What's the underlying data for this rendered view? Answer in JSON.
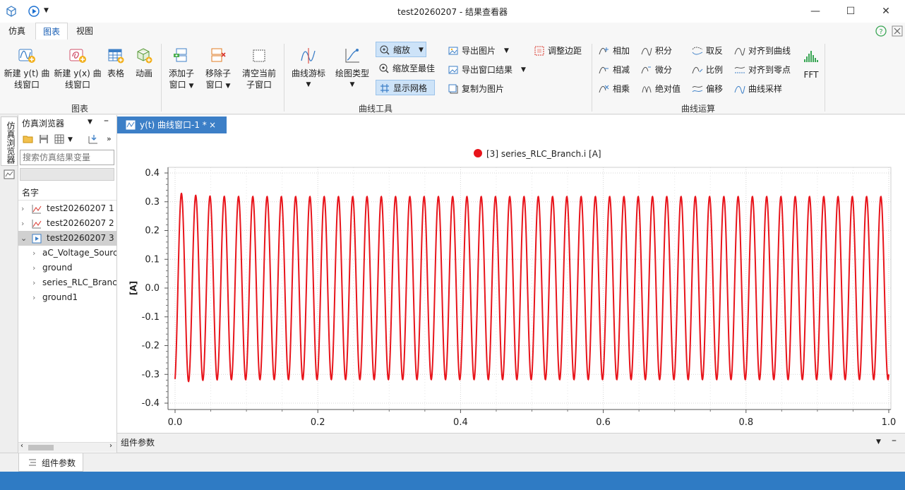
{
  "window": {
    "title": "test20260207 - 结果查看器",
    "minimize": "—",
    "maximize": "☐",
    "close": "✕"
  },
  "menu": {
    "tabs": [
      "仿真",
      "图表",
      "视图"
    ],
    "active_index": 1,
    "help": "?",
    "close_doc": "✕"
  },
  "ribbon": {
    "chart_group": {
      "label": "图表",
      "new_yt_line1": "新建 y(t) 曲",
      "new_yt_line2": "线窗口",
      "new_yx_line1": "新建 y(x) 曲",
      "new_yx_line2": "线窗口",
      "table": "表格",
      "animation": "动画"
    },
    "curve_tools": {
      "label": "曲线工具",
      "add_sub_line1": "添加子",
      "add_sub_line2": "窗口",
      "remove_sub_line1": "移除子",
      "remove_sub_line2": "窗口",
      "clear_sub_line1": "清空当前",
      "clear_sub_line2": "子窗口",
      "cursor": "曲线游标",
      "plot_type": "绘图类型",
      "zoom": "缩放",
      "zoom_best": "缩放至最佳",
      "show_grid": "显示网格",
      "export_image": "导出图片",
      "export_window": "导出窗口结果",
      "copy_image": "复制为图片",
      "adjust_margin": "调整边距"
    },
    "curve_ops": {
      "label": "曲线运算",
      "add": "相加",
      "integral": "积分",
      "negate": "取反",
      "align_curve": "对齐到曲线",
      "subtract": "相减",
      "derivative": "微分",
      "scale": "比例",
      "align_zero": "对齐到零点",
      "multiply": "相乘",
      "abs": "绝对值",
      "offset": "偏移",
      "sample": "曲线采样",
      "fft": "FFT"
    }
  },
  "sidebar": {
    "strip_label": "仿真浏览器",
    "title": "仿真浏览器",
    "search_placeholder": "搜索仿真结果变量",
    "column_header": "名字",
    "items": [
      {
        "label": "test20260207 1"
      },
      {
        "label": "test20260207 2"
      },
      {
        "label": "test20260207 3"
      },
      {
        "label": "aC_Voltage_Source"
      },
      {
        "label": "ground"
      },
      {
        "label": "series_RLC_Branch"
      },
      {
        "label": "ground1"
      }
    ]
  },
  "doc_tab": {
    "label": "y(t) 曲线窗口-1 *",
    "close": "×"
  },
  "params_bar": {
    "label": "组件参数"
  },
  "bottom_tab": {
    "label": "组件参数"
  },
  "chart_data": {
    "type": "line",
    "legend": "[3] series_RLC_Branch.i [A]",
    "legend_position": "top-center",
    "ylabel": "[A]",
    "xlabel": "",
    "xlim": [
      0,
      1
    ],
    "ylim": [
      -0.4,
      0.4
    ],
    "x_ticks": [
      "0.0",
      "0.2",
      "0.4",
      "0.6",
      "0.8",
      "1.0"
    ],
    "y_ticks": [
      "0.4",
      "0.3",
      "0.2",
      "0.1",
      "0.0",
      "-0.1",
      "-0.2",
      "-0.3",
      "-0.4"
    ],
    "grid": true,
    "series": [
      {
        "name": "[3] series_RLC_Branch.i [A]",
        "color": "#e8141b",
        "waveform": "sine",
        "frequency_hz": 50,
        "amplitude": 0.318,
        "start_value": -0.3,
        "first_peak": 0.335,
        "x_start": 0,
        "x_end": 1
      }
    ]
  },
  "colors": {
    "accent": "#3c7fc7",
    "series": "#e8141b",
    "statusbar": "#2f7bc4"
  }
}
